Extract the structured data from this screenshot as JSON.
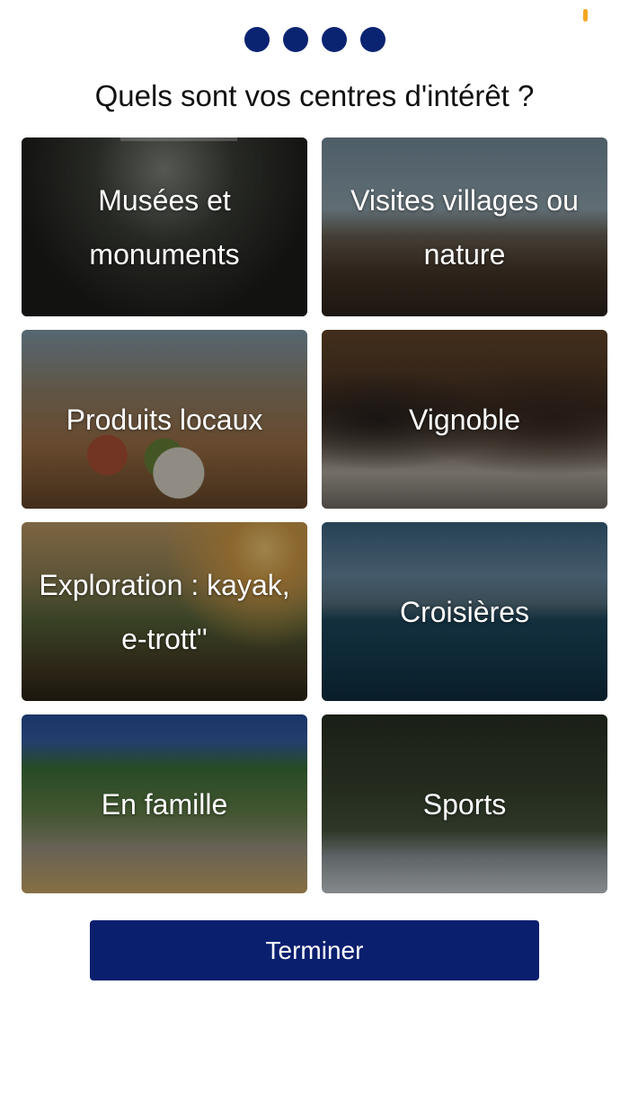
{
  "status": {
    "indicator_color": "#f5a623"
  },
  "pager": {
    "count": 4,
    "active_color": "#0b2472"
  },
  "title": "Quels sont vos centres d'intérêt ?",
  "interests": [
    {
      "label": "Musées et monuments",
      "image": "museum-gallery"
    },
    {
      "label": "Visites villages ou nature",
      "image": "village-rooftops"
    },
    {
      "label": "Produits locaux",
      "image": "local-products-market"
    },
    {
      "label": "Vignoble",
      "image": "wine-tasting"
    },
    {
      "label": "Exploration : kayak, e-trott''",
      "image": "ebike-ride"
    },
    {
      "label": "Croisières",
      "image": "boat-on-lake"
    },
    {
      "label": "En famille",
      "image": "family-canal"
    },
    {
      "label": "Sports",
      "image": "windsurf"
    }
  ],
  "finish_button": {
    "label": "Terminer",
    "color": "#0a1f6e"
  }
}
